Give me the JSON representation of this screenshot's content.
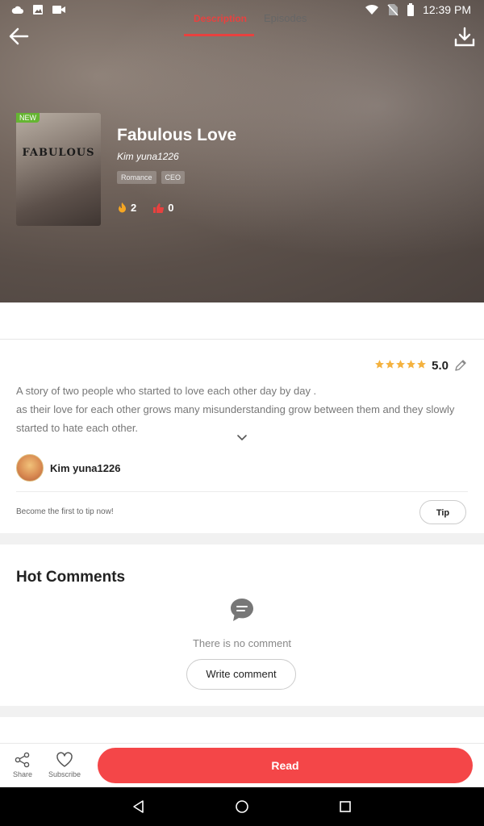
{
  "status_bar": {
    "time": "12:39 PM",
    "left_icons": [
      "cloud-icon",
      "image-icon",
      "video-icon"
    ],
    "right_icons": [
      "wifi-icon",
      "no-sim-icon",
      "battery-icon"
    ]
  },
  "header": {
    "back_icon": "arrow-left-icon",
    "download_icon": "download-icon"
  },
  "book": {
    "badge": "NEW",
    "cover_text": "FABULOUS",
    "title": "Fabulous Love",
    "author": "Kim yuna1226",
    "tags": [
      "Romance",
      "CEO"
    ],
    "fire_count": "2",
    "like_count": "0"
  },
  "tabs": {
    "description": "Description",
    "episodes": "Episodes",
    "active": "Description"
  },
  "rating": {
    "stars": 5,
    "value": "5.0"
  },
  "description": {
    "line1": "A story of two people who started to love each other day by day .",
    "line2": "as their love for each other grows many misunderstanding grow between them and they slowly started to hate each other."
  },
  "author_row": {
    "name": "Kim yuna1226"
  },
  "tip": {
    "prompt": "Become the first to tip now!",
    "button": "Tip"
  },
  "comments": {
    "title": "Hot Comments",
    "empty_text": "There is no comment",
    "write_button": "Write comment"
  },
  "bottom_bar": {
    "share_label": "Share",
    "subscribe_label": "Subscribe",
    "read_label": "Read"
  },
  "colors": {
    "accent": "#e8413f",
    "read_button": "#f44648",
    "star": "#f4b23f",
    "new_badge": "#65b532"
  }
}
